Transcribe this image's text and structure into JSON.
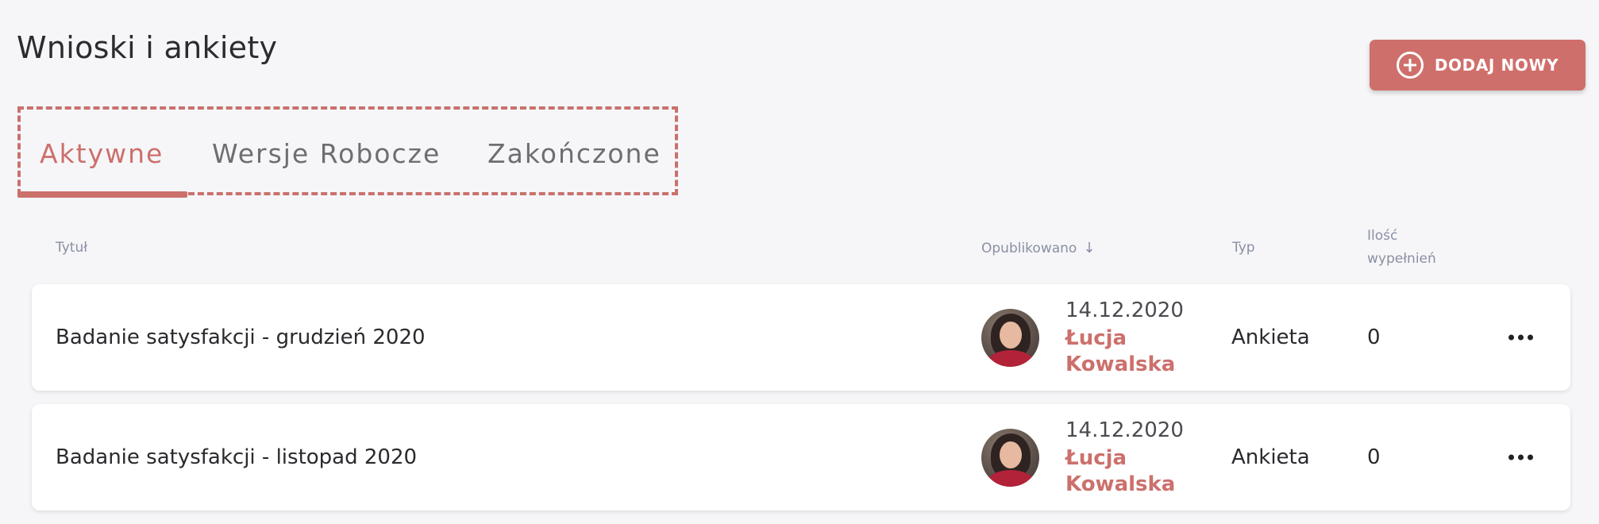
{
  "page": {
    "title": "Wnioski i ankiety"
  },
  "toolbar": {
    "add_label": "DODAJ NOWY",
    "add_icon": "plus-circle-icon"
  },
  "tabs": [
    {
      "label": "Aktywne",
      "active": true
    },
    {
      "label": "Wersje Robocze",
      "active": false
    },
    {
      "label": "Zakończone",
      "active": false
    }
  ],
  "table": {
    "headers": {
      "title": "Tytuł",
      "published": "Opublikowano",
      "published_sort_icon": "arrow-down-icon",
      "type": "Typ",
      "count_line1": "Ilość",
      "count_line2": "wypełnień"
    },
    "rows": [
      {
        "title": "Badanie satysfakcji - grudzień 2020",
        "date": "14.12.2020",
        "author": "Łucja Kowalska",
        "type": "Ankieta",
        "count": "0",
        "menu_icon": "more-horizontal-icon"
      },
      {
        "title": "Badanie satysfakcji - listopad 2020",
        "date": "14.12.2020",
        "author": "Łucja Kowalska",
        "type": "Ankieta",
        "count": "0",
        "menu_icon": "more-horizontal-icon"
      }
    ]
  },
  "colors": {
    "accent": "#cc706c",
    "background": "#f6f6f8",
    "header_text": "#8a8fa3"
  }
}
